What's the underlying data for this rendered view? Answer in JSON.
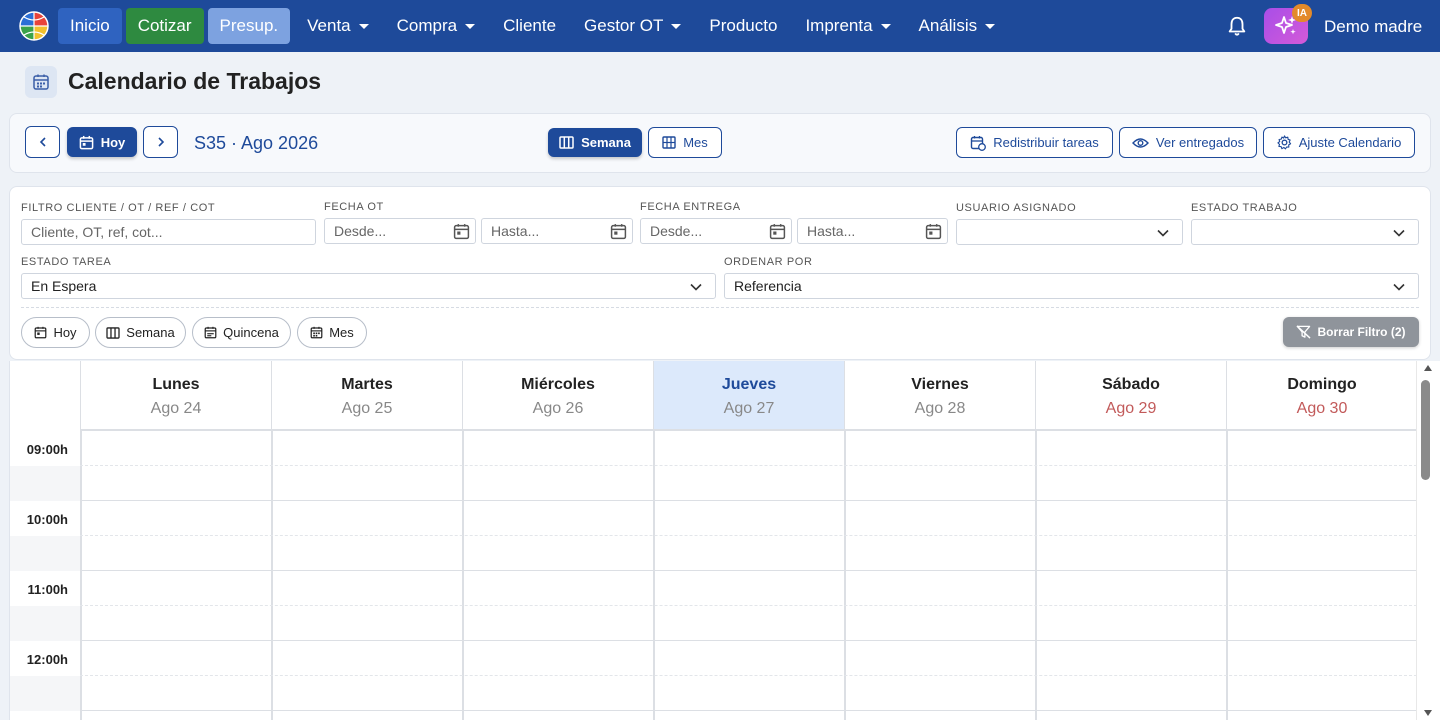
{
  "navbar": {
    "items": [
      {
        "label": "Inicio",
        "dropdown": false
      },
      {
        "label": "Cotizar",
        "dropdown": false
      },
      {
        "label": "Presup.",
        "dropdown": false
      },
      {
        "label": "Venta",
        "dropdown": true
      },
      {
        "label": "Compra",
        "dropdown": true
      },
      {
        "label": "Cliente",
        "dropdown": false
      },
      {
        "label": "Gestor OT",
        "dropdown": true
      },
      {
        "label": "Producto",
        "dropdown": false
      },
      {
        "label": "Imprenta",
        "dropdown": true
      },
      {
        "label": "Análisis",
        "dropdown": true
      }
    ],
    "ia_badge": "IA",
    "user_name": "Demo madre"
  },
  "page": {
    "title": "Calendario de Trabajos"
  },
  "toolbar": {
    "today_label": "Hoy",
    "week_label": "S35 · Ago 2026",
    "view_week": "Semana",
    "view_month": "Mes",
    "redistribute": "Redistribuir tareas",
    "view_delivered": "Ver entregados",
    "settings": "Ajuste Calendario"
  },
  "filters": {
    "client": {
      "label": "FILTRO CLIENTE / OT / REF / COT",
      "placeholder": "Cliente, OT, ref, cot..."
    },
    "ot_date": {
      "label": "FECHA OT",
      "from": "Desde...",
      "to": "Hasta..."
    },
    "delivery_date": {
      "label": "FECHA ENTREGA",
      "from": "Desde...",
      "to": "Hasta..."
    },
    "assigned_user": {
      "label": "USUARIO ASIGNADO",
      "value": ""
    },
    "job_status": {
      "label": "ESTADO TRABAJO",
      "value": ""
    },
    "task_status": {
      "label": "ESTADO TAREA",
      "value": "En Espera"
    },
    "sort_by": {
      "label": "ORDENAR POR",
      "value": "Referencia"
    },
    "quick": [
      "Hoy",
      "Semana",
      "Quincena",
      "Mes"
    ],
    "clear": "Borrar Filtro (2)"
  },
  "calendar": {
    "days": [
      {
        "name": "Lunes",
        "date": "Ago 24",
        "today": false,
        "weekend": false
      },
      {
        "name": "Martes",
        "date": "Ago 25",
        "today": false,
        "weekend": false
      },
      {
        "name": "Miércoles",
        "date": "Ago 26",
        "today": false,
        "weekend": false
      },
      {
        "name": "Jueves",
        "date": "Ago 27",
        "today": true,
        "weekend": false
      },
      {
        "name": "Viernes",
        "date": "Ago 28",
        "today": false,
        "weekend": false
      },
      {
        "name": "Sábado",
        "date": "Ago 29",
        "today": false,
        "weekend": true
      },
      {
        "name": "Domingo",
        "date": "Ago 30",
        "today": false,
        "weekend": true
      }
    ],
    "hours": [
      "09:00h",
      "10:00h",
      "11:00h",
      "12:00h"
    ]
  }
}
